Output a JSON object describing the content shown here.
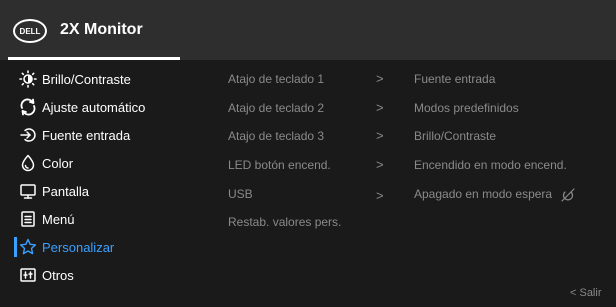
{
  "header": {
    "logo_text": "DELL",
    "title": "2X Monitor"
  },
  "menu": [
    {
      "label": "Brillo/Contraste",
      "icon": "brightness-icon"
    },
    {
      "label": "Ajuste automático",
      "icon": "auto-adjust-icon"
    },
    {
      "label": "Fuente entrada",
      "icon": "input-source-icon"
    },
    {
      "label": "Color",
      "icon": "color-palette-icon"
    },
    {
      "label": "Pantalla",
      "icon": "display-icon"
    },
    {
      "label": "Menú",
      "icon": "menu-icon"
    },
    {
      "label": "Personalizar",
      "icon": "star-icon",
      "selected": true
    },
    {
      "label": "Otros",
      "icon": "others-icon"
    }
  ],
  "submenu": [
    {
      "label": "Atajo de teclado 1",
      "value": "Fuente entrada"
    },
    {
      "label": "Atajo de teclado 2",
      "value": "Modos predefinidos"
    },
    {
      "label": "Atajo de teclado 3",
      "value": "Brillo/Contraste"
    },
    {
      "label": "LED botón encend.",
      "value": "Encendido en modo encend."
    },
    {
      "label": "USB",
      "value": "Apagado en modo espera"
    },
    {
      "label": "Restab. valores pers.",
      "value": ""
    }
  ],
  "exit_label": "< Salir",
  "colors": {
    "accent": "#3aa0ff",
    "text": "#ffffff",
    "muted": "#8a8a8a",
    "header_bg": "#2e2e2e",
    "body_bg": "#1a1a1a"
  }
}
